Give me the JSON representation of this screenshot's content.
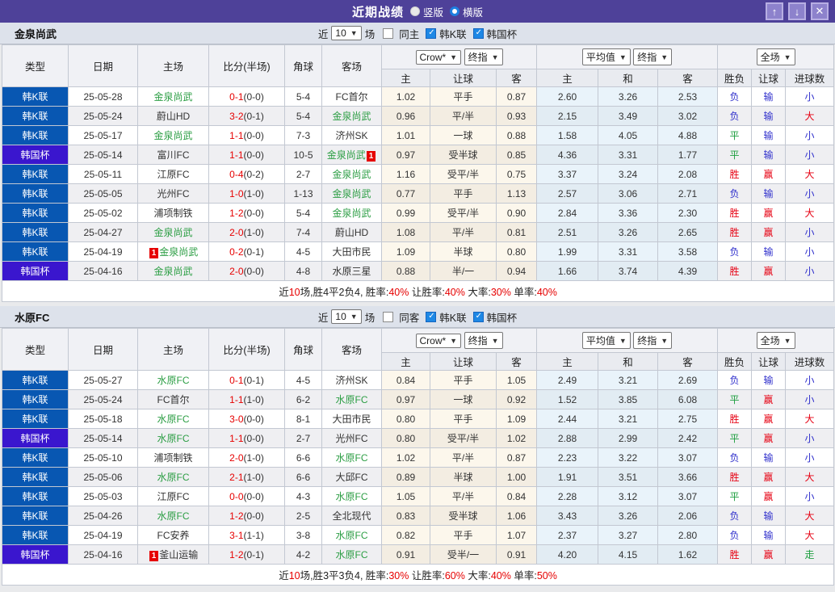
{
  "titlebar": {
    "title": "近期战绩",
    "radio_vertical": "竖版",
    "radio_horizontal": "横版",
    "up_icon": "↑",
    "down_icon": "↓",
    "close_icon": "✕",
    "bar_color": "#4e4199",
    "button_color": "#8d82cc"
  },
  "controls": {
    "near": "近",
    "count": "10",
    "games": "场",
    "k_league": "韩K联",
    "cup": "韩国杯",
    "crow": "Crow*",
    "final1": "终指",
    "avg": "平均值",
    "final2": "终指",
    "full": "全场"
  },
  "columns": {
    "type": "类型",
    "date": "日期",
    "home": "主场",
    "score": "比分(半场)",
    "corner": "角球",
    "away": "客场",
    "let_home": "主",
    "let_line": "让球",
    "let_away": "客",
    "avg_home": "主",
    "avg_draw": "和",
    "avg_away": "客",
    "wdl": "胜负",
    "let_result": "让球",
    "goals": "进球数"
  },
  "result_colors": {
    "胜": "r-red",
    "平": "r-grn",
    "负": "r-blue",
    "赢": "r-red",
    "输": "r-blue",
    "大": "r-red",
    "小": "r-blue",
    "走": "r-grn"
  },
  "tables": [
    {
      "team": "金泉尚武",
      "same_label": "同主",
      "rows": [
        {
          "lg": "韩K联",
          "cup": false,
          "date": "25-05-28",
          "h": "金泉尚武",
          "hg": true,
          "a": "FC首尔",
          "ag": false,
          "sc": "0-1",
          "hf": "(0-0)",
          "cn": "5-4",
          "let": [
            "1.02",
            "平手",
            "0.87"
          ],
          "avg": [
            "2.60",
            "3.26",
            "2.53"
          ],
          "res": [
            "负",
            "输",
            "小"
          ]
        },
        {
          "lg": "韩K联",
          "cup": false,
          "date": "25-05-24",
          "h": "蔚山HD",
          "hg": false,
          "a": "金泉尚武",
          "ag": true,
          "sc": "3-2",
          "hf": "(0-1)",
          "cn": "5-4",
          "let": [
            "0.96",
            "平/半",
            "0.93"
          ],
          "avg": [
            "2.15",
            "3.49",
            "3.02"
          ],
          "res": [
            "负",
            "输",
            "大"
          ]
        },
        {
          "lg": "韩K联",
          "cup": false,
          "date": "25-05-17",
          "h": "金泉尚武",
          "hg": true,
          "a": "济州SK",
          "ag": false,
          "sc": "1-1",
          "hf": "(0-0)",
          "cn": "7-3",
          "let": [
            "1.01",
            "一球",
            "0.88"
          ],
          "avg": [
            "1.58",
            "4.05",
            "4.88"
          ],
          "res": [
            "平",
            "输",
            "小"
          ]
        },
        {
          "lg": "韩国杯",
          "cup": true,
          "date": "25-05-14",
          "h": "富川FC",
          "hg": false,
          "a": "金泉尚武",
          "ag": true,
          "ab": "1",
          "abp": "after",
          "sc": "1-1",
          "hf": "(0-0)",
          "cn": "10-5",
          "let": [
            "0.97",
            "受半球",
            "0.85"
          ],
          "avg": [
            "4.36",
            "3.31",
            "1.77"
          ],
          "res": [
            "平",
            "输",
            "小"
          ]
        },
        {
          "lg": "韩K联",
          "cup": false,
          "date": "25-05-11",
          "h": "江原FC",
          "hg": false,
          "a": "金泉尚武",
          "ag": true,
          "sc": "0-4",
          "hf": "(0-2)",
          "cn": "2-7",
          "let": [
            "1.16",
            "受平/半",
            "0.75"
          ],
          "avg": [
            "3.37",
            "3.24",
            "2.08"
          ],
          "res": [
            "胜",
            "赢",
            "大"
          ]
        },
        {
          "lg": "韩K联",
          "cup": false,
          "date": "25-05-05",
          "h": "光州FC",
          "hg": false,
          "a": "金泉尚武",
          "ag": true,
          "sc": "1-0",
          "hf": "(1-0)",
          "cn": "1-13",
          "let": [
            "0.77",
            "平手",
            "1.13"
          ],
          "avg": [
            "2.57",
            "3.06",
            "2.71"
          ],
          "res": [
            "负",
            "输",
            "小"
          ]
        },
        {
          "lg": "韩K联",
          "cup": false,
          "date": "25-05-02",
          "h": "浦项制铁",
          "hg": false,
          "a": "金泉尚武",
          "ag": true,
          "sc": "1-2",
          "hf": "(0-0)",
          "cn": "5-4",
          "let": [
            "0.99",
            "受平/半",
            "0.90"
          ],
          "avg": [
            "2.84",
            "3.36",
            "2.30"
          ],
          "res": [
            "胜",
            "赢",
            "大"
          ]
        },
        {
          "lg": "韩K联",
          "cup": false,
          "date": "25-04-27",
          "h": "金泉尚武",
          "hg": true,
          "a": "蔚山HD",
          "ag": false,
          "sc": "2-0",
          "hf": "(1-0)",
          "cn": "7-4",
          "let": [
            "1.08",
            "平/半",
            "0.81"
          ],
          "avg": [
            "2.51",
            "3.26",
            "2.65"
          ],
          "res": [
            "胜",
            "赢",
            "小"
          ]
        },
        {
          "lg": "韩K联",
          "cup": false,
          "date": "25-04-19",
          "h": "金泉尚武",
          "hg": true,
          "hb": "1",
          "hbp": "before",
          "a": "大田市民",
          "ag": false,
          "sc": "0-2",
          "hf": "(0-1)",
          "cn": "4-5",
          "let": [
            "1.09",
            "半球",
            "0.80"
          ],
          "avg": [
            "1.99",
            "3.31",
            "3.58"
          ],
          "res": [
            "负",
            "输",
            "小"
          ]
        },
        {
          "lg": "韩国杯",
          "cup": true,
          "date": "25-04-16",
          "h": "金泉尚武",
          "hg": true,
          "a": "水原三星",
          "ag": false,
          "sc": "2-0",
          "hf": "(0-0)",
          "cn": "4-8",
          "let": [
            "0.88",
            "半/一",
            "0.94"
          ],
          "avg": [
            "1.66",
            "3.74",
            "4.39"
          ],
          "res": [
            "胜",
            "赢",
            "小"
          ]
        }
      ],
      "summary": [
        [
          "近",
          0
        ],
        [
          "10",
          1
        ],
        [
          "场,胜4平2负4, 胜率:",
          0
        ],
        [
          "40%",
          1
        ],
        [
          " 让胜率:",
          0
        ],
        [
          "40%",
          1
        ],
        [
          " 大率:",
          0
        ],
        [
          "30%",
          1
        ],
        [
          " 单率:",
          0
        ],
        [
          "40%",
          1
        ]
      ]
    },
    {
      "team": "水原FC",
      "same_label": "同客",
      "rows": [
        {
          "lg": "韩K联",
          "cup": false,
          "date": "25-05-27",
          "h": "水原FC",
          "hg": true,
          "a": "济州SK",
          "ag": false,
          "sc": "0-1",
          "hf": "(0-1)",
          "cn": "4-5",
          "let": [
            "0.84",
            "平手",
            "1.05"
          ],
          "avg": [
            "2.49",
            "3.21",
            "2.69"
          ],
          "res": [
            "负",
            "输",
            "小"
          ]
        },
        {
          "lg": "韩K联",
          "cup": false,
          "date": "25-05-24",
          "h": "FC首尔",
          "hg": false,
          "a": "水原FC",
          "ag": true,
          "sc": "1-1",
          "hf": "(1-0)",
          "cn": "6-2",
          "let": [
            "0.97",
            "一球",
            "0.92"
          ],
          "avg": [
            "1.52",
            "3.85",
            "6.08"
          ],
          "res": [
            "平",
            "赢",
            "小"
          ]
        },
        {
          "lg": "韩K联",
          "cup": false,
          "date": "25-05-18",
          "h": "水原FC",
          "hg": true,
          "a": "大田市民",
          "ag": false,
          "sc": "3-0",
          "hf": "(0-0)",
          "cn": "8-1",
          "let": [
            "0.80",
            "平手",
            "1.09"
          ],
          "avg": [
            "2.44",
            "3.21",
            "2.75"
          ],
          "res": [
            "胜",
            "赢",
            "大"
          ]
        },
        {
          "lg": "韩国杯",
          "cup": true,
          "date": "25-05-14",
          "h": "水原FC",
          "hg": true,
          "a": "光州FC",
          "ag": false,
          "sc": "1-1",
          "hf": "(0-0)",
          "cn": "2-7",
          "let": [
            "0.80",
            "受平/半",
            "1.02"
          ],
          "avg": [
            "2.88",
            "2.99",
            "2.42"
          ],
          "res": [
            "平",
            "赢",
            "小"
          ]
        },
        {
          "lg": "韩K联",
          "cup": false,
          "date": "25-05-10",
          "h": "浦项制铁",
          "hg": false,
          "a": "水原FC",
          "ag": true,
          "sc": "2-0",
          "hf": "(1-0)",
          "cn": "6-6",
          "let": [
            "1.02",
            "平/半",
            "0.87"
          ],
          "avg": [
            "2.23",
            "3.22",
            "3.07"
          ],
          "res": [
            "负",
            "输",
            "小"
          ]
        },
        {
          "lg": "韩K联",
          "cup": false,
          "date": "25-05-06",
          "h": "水原FC",
          "hg": true,
          "a": "大邱FC",
          "ag": false,
          "sc": "2-1",
          "hf": "(1-0)",
          "cn": "6-6",
          "let": [
            "0.89",
            "半球",
            "1.00"
          ],
          "avg": [
            "1.91",
            "3.51",
            "3.66"
          ],
          "res": [
            "胜",
            "赢",
            "大"
          ]
        },
        {
          "lg": "韩K联",
          "cup": false,
          "date": "25-05-03",
          "h": "江原FC",
          "hg": false,
          "a": "水原FC",
          "ag": true,
          "sc": "0-0",
          "hf": "(0-0)",
          "cn": "4-3",
          "let": [
            "1.05",
            "平/半",
            "0.84"
          ],
          "avg": [
            "2.28",
            "3.12",
            "3.07"
          ],
          "res": [
            "平",
            "赢",
            "小"
          ]
        },
        {
          "lg": "韩K联",
          "cup": false,
          "date": "25-04-26",
          "h": "水原FC",
          "hg": true,
          "a": "全北现代",
          "ag": false,
          "sc": "1-2",
          "hf": "(0-0)",
          "cn": "2-5",
          "let": [
            "0.83",
            "受半球",
            "1.06"
          ],
          "avg": [
            "3.43",
            "3.26",
            "2.06"
          ],
          "res": [
            "负",
            "输",
            "大"
          ]
        },
        {
          "lg": "韩K联",
          "cup": false,
          "date": "25-04-19",
          "h": "FC安养",
          "hg": false,
          "a": "水原FC",
          "ag": true,
          "sc": "3-1",
          "hf": "(1-1)",
          "cn": "3-8",
          "let": [
            "0.82",
            "平手",
            "1.07"
          ],
          "avg": [
            "2.37",
            "3.27",
            "2.80"
          ],
          "res": [
            "负",
            "输",
            "大"
          ]
        },
        {
          "lg": "韩国杯",
          "cup": true,
          "date": "25-04-16",
          "h": "釜山运输",
          "hg": false,
          "hb": "1",
          "hbp": "before",
          "a": "水原FC",
          "ag": true,
          "sc": "1-2",
          "hf": "(0-1)",
          "cn": "4-2",
          "let": [
            "0.91",
            "受半/一",
            "0.91"
          ],
          "avg": [
            "4.20",
            "4.15",
            "1.62"
          ],
          "res": [
            "胜",
            "赢",
            "走"
          ]
        }
      ],
      "summary": [
        [
          "近",
          0
        ],
        [
          "10",
          1
        ],
        [
          "场,胜3平3负4, 胜率:",
          0
        ],
        [
          "30%",
          1
        ],
        [
          " 让胜率:",
          0
        ],
        [
          "60%",
          1
        ],
        [
          " 大率:",
          0
        ],
        [
          "40%",
          1
        ],
        [
          " 单率:",
          0
        ],
        [
          "50%",
          1
        ]
      ]
    }
  ]
}
